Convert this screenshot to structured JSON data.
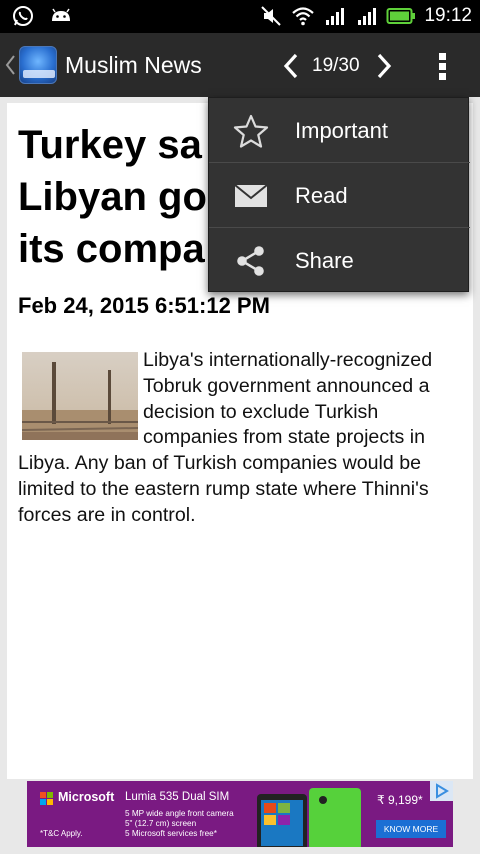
{
  "status_bar": {
    "time": "19:12",
    "left_icons": [
      "whatsapp-icon",
      "android-icon"
    ],
    "right_icons": [
      "muted-icon",
      "wifi-icon",
      "signal-icon",
      "signal-2-icon",
      "battery-icon"
    ]
  },
  "action_bar": {
    "app_title": "Muslim News",
    "counter": "19/30",
    "icons": [
      "back-chevron-icon",
      "app-logo",
      "previous-icon",
      "next-icon",
      "overflow-menu-icon"
    ]
  },
  "article": {
    "headline_visible": "Turkey sa\nLibyan go\nits compa",
    "datetime": "Feb 24, 2015 6:51:12 PM",
    "body": "Libya's internationally-recognized Tobruk government announced a decision to exclude Turkish companies from state projects in Libya. Any ban of Turkish companies would be limited to the eastern rump state where Thinni's forces are in control."
  },
  "menu": {
    "items": [
      {
        "label": "Important",
        "icon": "star-icon"
      },
      {
        "label": "Read",
        "icon": "envelope-icon"
      },
      {
        "label": "Share",
        "icon": "share-icon"
      }
    ]
  },
  "ad": {
    "brand": "Microsoft",
    "product": "Lumia 535 Dual SIM",
    "spec_1": "5 MP wide angle front camera",
    "spec_2": "5\" (12.7 cm) screen",
    "spec_3": "5 Microsoft services free*",
    "price": "₹ 9,199*",
    "cta": "KNOW MORE",
    "disclaimer": "*T&C Apply.",
    "background_color": "#7a1a82",
    "cta_color": "#1b6fd4"
  },
  "colors": {
    "action_bar": "#2a2a2a",
    "status_bar": "#000000",
    "menu_bg": "#333333"
  }
}
